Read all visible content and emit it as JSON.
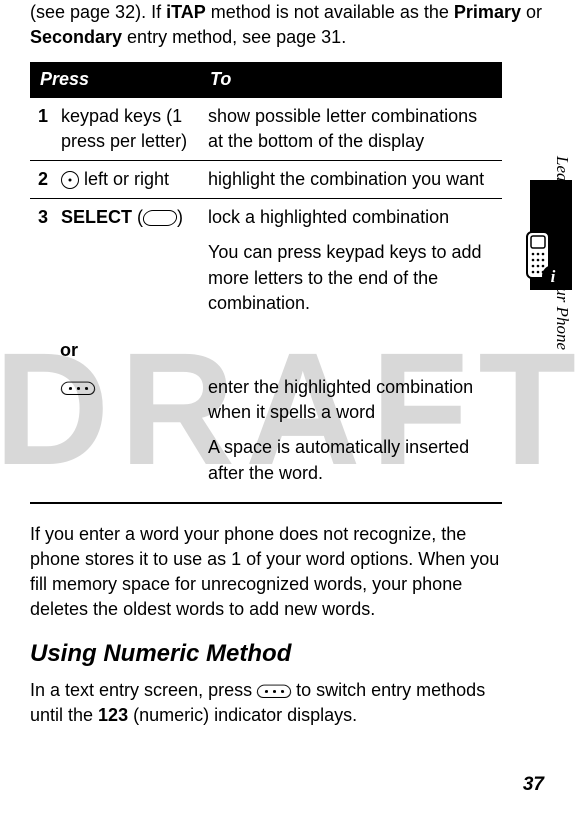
{
  "watermark": "DRAFT",
  "intro": {
    "part1": "(see page 32). If ",
    "itap": "iTAP",
    "part2": " method is not available as the ",
    "primary": "Primary",
    "part3": " or ",
    "secondary": "Secondary",
    "part4": " entry method, see page 31."
  },
  "table": {
    "headers": {
      "press": "Press",
      "to": "To"
    },
    "rows": [
      {
        "num": "1",
        "press": "keypad keys (1 press per letter)",
        "to": "show possible letter combinations at the bottom of the display"
      },
      {
        "num": "2",
        "press_suffix": " left or right",
        "to": " highlight the combination you want"
      },
      {
        "num": "3",
        "select": "SELECT",
        "to_a": "lock a highlighted combination",
        "to_b": "You can press keypad keys to add more letters to the end of the combination.",
        "or": "or",
        "to_c": "enter the highlighted combination when it spells a word",
        "to_d": "A space is automatically inserted after the word."
      }
    ]
  },
  "body_para": "If you enter a word your phone does not recognize, the phone stores it to use as 1 of your word options. When you fill memory space for unrecognized words, your phone deletes the oldest words to add new words.",
  "heading": "Using Numeric Method",
  "numeric_para": {
    "a": "In a text entry screen, press ",
    "b": " to switch entry methods until the ",
    "indicator": "123",
    "c": " (numeric) indicator displays."
  },
  "side_label": "Learning to Use Your Phone",
  "page_number": "37"
}
